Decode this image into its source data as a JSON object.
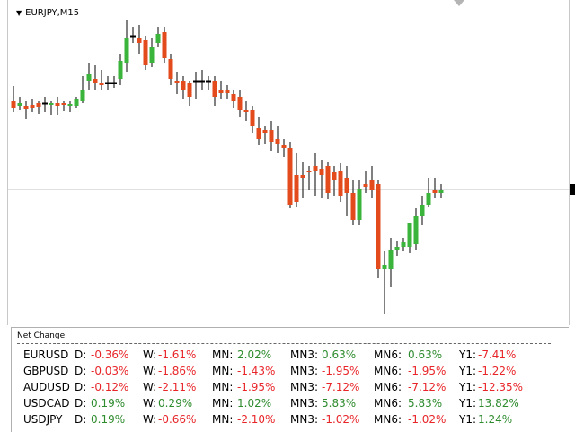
{
  "chart": {
    "symbol": "EURJPY,M15",
    "bull_color": "#3ab43a",
    "bear_color": "#e34b1d",
    "wick_color": "#000000",
    "grid_color": "#c0c0c0"
  },
  "panel": {
    "title": "Net Change",
    "rows": [
      {
        "symbol": "EURUSD",
        "cells": [
          {
            "label": "D:",
            "value": "-0.36%",
            "sign": "neg"
          },
          {
            "label": "W:",
            "value": "-1.61%",
            "sign": "neg"
          },
          {
            "label": "MN:",
            "value": "2.02%",
            "sign": "pos"
          },
          {
            "label": "MN3:",
            "value": "0.63%",
            "sign": "pos"
          },
          {
            "label": "MN6:",
            "value": "0.63%",
            "sign": "pos"
          },
          {
            "label": "Y1:",
            "value": "-7.41%",
            "sign": "neg"
          }
        ]
      },
      {
        "symbol": "GBPUSD",
        "cells": [
          {
            "label": "D:",
            "value": "-0.03%",
            "sign": "neg"
          },
          {
            "label": "W:",
            "value": "-1.86%",
            "sign": "neg"
          },
          {
            "label": "MN:",
            "value": "-1.43%",
            "sign": "neg"
          },
          {
            "label": "MN3:",
            "value": "-1.95%",
            "sign": "neg"
          },
          {
            "label": "MN6:",
            "value": "-1.95%",
            "sign": "neg"
          },
          {
            "label": "Y1:",
            "value": "-1.22%",
            "sign": "neg"
          }
        ]
      },
      {
        "symbol": "AUDUSD",
        "cells": [
          {
            "label": "D:",
            "value": "-0.12%",
            "sign": "neg"
          },
          {
            "label": "W:",
            "value": "-2.11%",
            "sign": "neg"
          },
          {
            "label": "MN:",
            "value": "-1.95%",
            "sign": "neg"
          },
          {
            "label": "MN3:",
            "value": "-7.12%",
            "sign": "neg"
          },
          {
            "label": "MN6:",
            "value": "-7.12%",
            "sign": "neg"
          },
          {
            "label": "Y1:",
            "value": "-12.35%",
            "sign": "neg"
          }
        ]
      },
      {
        "symbol": "USDCAD",
        "cells": [
          {
            "label": "D:",
            "value": "0.19%",
            "sign": "pos"
          },
          {
            "label": "W:",
            "value": "0.29%",
            "sign": "pos"
          },
          {
            "label": "MN:",
            "value": "1.02%",
            "sign": "pos"
          },
          {
            "label": "MN3:",
            "value": "5.83%",
            "sign": "pos"
          },
          {
            "label": "MN6:",
            "value": "5.83%",
            "sign": "pos"
          },
          {
            "label": "Y1:",
            "value": "13.82%",
            "sign": "pos"
          }
        ]
      },
      {
        "symbol": "USDJPY",
        "cells": [
          {
            "label": "D:",
            "value": "0.19%",
            "sign": "pos"
          },
          {
            "label": "W:",
            "value": "-0.66%",
            "sign": "neg"
          },
          {
            "label": "MN:",
            "value": "-2.10%",
            "sign": "neg"
          },
          {
            "label": "MN3:",
            "value": "-1.02%",
            "sign": "neg"
          },
          {
            "label": "MN6:",
            "value": "-1.02%",
            "sign": "neg"
          },
          {
            "label": "Y1:",
            "value": "1.24%",
            "sign": "pos"
          }
        ]
      }
    ]
  }
}
